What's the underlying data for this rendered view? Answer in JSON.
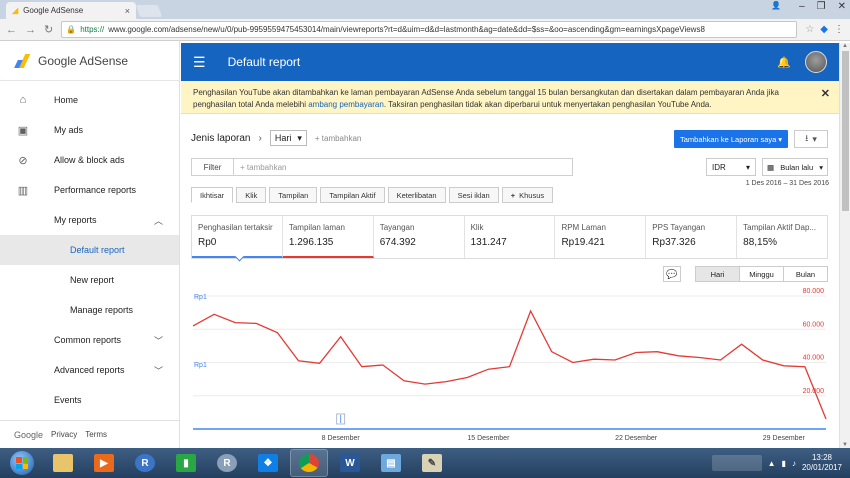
{
  "browser": {
    "tab_title": "Google AdSense",
    "url_proto": "https://",
    "url_rest": "www.google.com/adsense/new/u/0/pub-9959559475453014/main/viewreports?rt=d&uim=d&d=lastmonth&ag=date&dd=$ss=&oo=ascending&gm=earningsXpageViews8"
  },
  "sidebar": {
    "logo_text": "Google AdSense",
    "items": [
      {
        "label": "Home",
        "icon": "home-icon"
      },
      {
        "label": "My ads",
        "icon": "ads-icon"
      },
      {
        "label": "Allow & block ads",
        "icon": "block-icon"
      },
      {
        "label": "Performance reports",
        "icon": "bar-chart-icon"
      },
      {
        "label": "My reports"
      },
      {
        "label": "Default report"
      },
      {
        "label": "New report"
      },
      {
        "label": "Manage reports"
      },
      {
        "label": "Common reports"
      },
      {
        "label": "Advanced reports"
      },
      {
        "label": "Events"
      }
    ],
    "footer": {
      "google": "Google",
      "privacy": "Privacy",
      "terms": "Terms"
    }
  },
  "header": {
    "title": "Default report"
  },
  "banner": {
    "text_before": "Penghasilan YouTube akan ditambahkan ke laman pembayaran AdSense Anda sebelum tanggal 15 bulan bersangkutan dan disertakan dalam pembayaran Anda jika penghasilan total Anda melebihi ",
    "link": "ambang pembayaran",
    "text_after": ". Taksiran penghasilan tidak akan diperbarui untuk menyertakan penghasilan YouTube Anda."
  },
  "report": {
    "report_type_label": "Jenis laporan",
    "dimension": "Hari",
    "add_label": "+ tambahkan",
    "add_to_reports_button": "Tambahkan ke Laporan saya",
    "filter_label": "Filter",
    "filter_placeholder": "+ tambahkan",
    "currency": "IDR",
    "date_range_label": "Bulan lalu",
    "date_range_text": "1 Des 2016 – 31 Des 2016",
    "tabs": [
      "Ikhtisar",
      "Klik",
      "Tampilan",
      "Tampilan Aktif",
      "Keterlibatan",
      "Sesi iklan",
      "Khusus"
    ],
    "tabs_add_sign": "+",
    "metrics": [
      {
        "label": "Penghasilan tertaksir",
        "value": "Rp0"
      },
      {
        "label": "Tampilan laman",
        "value": "1.296.135"
      },
      {
        "label": "Tayangan",
        "value": "674.392"
      },
      {
        "label": "Klik",
        "value": "131.247"
      },
      {
        "label": "RPM Laman",
        "value": "Rp19.421"
      },
      {
        "label": "PPS Tayangan",
        "value": "Rp37.326"
      },
      {
        "label": "Tampilan Aktif Dap...",
        "value": "88,15%"
      }
    ],
    "granularity": [
      "Hari",
      "Minggu",
      "Bulan"
    ]
  },
  "chart_data": {
    "type": "line",
    "x_tick_labels": [
      "8 Desember",
      "15 Desember",
      "22 Desember",
      "29 Desember"
    ],
    "x_tick_days": [
      8,
      15,
      22,
      29
    ],
    "left_axis_labels": [
      "Rp1",
      "Rp1"
    ],
    "right_axis_labels": [
      "80.000",
      "60.000",
      "40.000",
      "20.000"
    ],
    "right_axis_ticks": [
      80000,
      60000,
      40000,
      20000
    ],
    "y2lim": [
      0,
      80000
    ],
    "series": [
      {
        "color": "#e53935",
        "axis": "right",
        "x": [
          1,
          2,
          3,
          4,
          5,
          6,
          7,
          8,
          9,
          10,
          11,
          12,
          13,
          14,
          15,
          16,
          17,
          18,
          19,
          20,
          21,
          22,
          23,
          24,
          25,
          26,
          27,
          28,
          29,
          30,
          31
        ],
        "values": [
          62000,
          69000,
          64000,
          63500,
          58000,
          41000,
          39500,
          55500,
          37500,
          38500,
          29000,
          27000,
          28500,
          31000,
          36000,
          37500,
          71000,
          46500,
          40000,
          42000,
          41500,
          46000,
          46500,
          44000,
          43000,
          41500,
          51000,
          41500,
          38000,
          37500,
          6000
        ]
      },
      {
        "color": "#4285f4",
        "axis": "left",
        "x": [
          1,
          31
        ],
        "values": [
          0,
          0
        ]
      }
    ],
    "grid": true,
    "annotation_marker_day": 8
  },
  "taskbar": {
    "clock_time": "13:28",
    "clock_date": "20/01/2017"
  }
}
